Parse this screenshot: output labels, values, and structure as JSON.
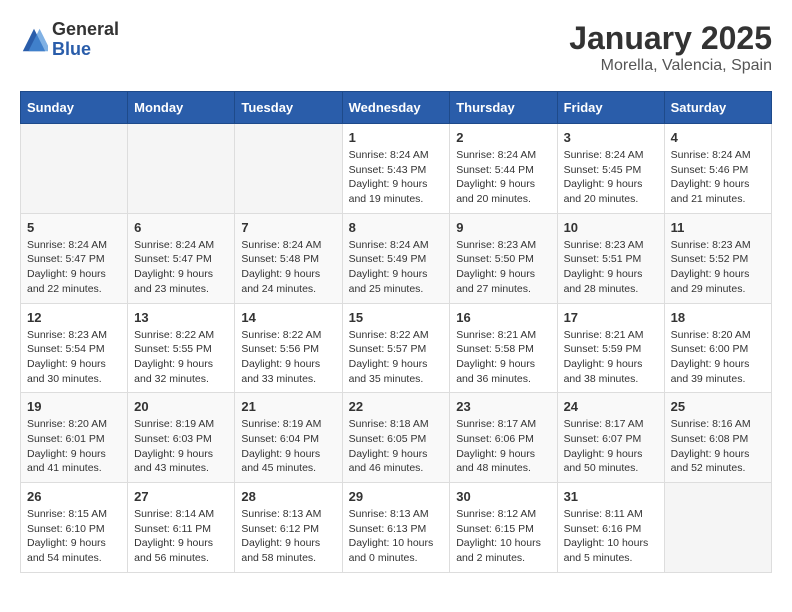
{
  "logo": {
    "general": "General",
    "blue": "Blue"
  },
  "title": "January 2025",
  "location": "Morella, Valencia, Spain",
  "weekdays": [
    "Sunday",
    "Monday",
    "Tuesday",
    "Wednesday",
    "Thursday",
    "Friday",
    "Saturday"
  ],
  "weeks": [
    [
      {
        "day": "",
        "info": ""
      },
      {
        "day": "",
        "info": ""
      },
      {
        "day": "",
        "info": ""
      },
      {
        "day": "1",
        "info": "Sunrise: 8:24 AM\nSunset: 5:43 PM\nDaylight: 9 hours and 19 minutes."
      },
      {
        "day": "2",
        "info": "Sunrise: 8:24 AM\nSunset: 5:44 PM\nDaylight: 9 hours and 20 minutes."
      },
      {
        "day": "3",
        "info": "Sunrise: 8:24 AM\nSunset: 5:45 PM\nDaylight: 9 hours and 20 minutes."
      },
      {
        "day": "4",
        "info": "Sunrise: 8:24 AM\nSunset: 5:46 PM\nDaylight: 9 hours and 21 minutes."
      }
    ],
    [
      {
        "day": "5",
        "info": "Sunrise: 8:24 AM\nSunset: 5:47 PM\nDaylight: 9 hours and 22 minutes."
      },
      {
        "day": "6",
        "info": "Sunrise: 8:24 AM\nSunset: 5:47 PM\nDaylight: 9 hours and 23 minutes."
      },
      {
        "day": "7",
        "info": "Sunrise: 8:24 AM\nSunset: 5:48 PM\nDaylight: 9 hours and 24 minutes."
      },
      {
        "day": "8",
        "info": "Sunrise: 8:24 AM\nSunset: 5:49 PM\nDaylight: 9 hours and 25 minutes."
      },
      {
        "day": "9",
        "info": "Sunrise: 8:23 AM\nSunset: 5:50 PM\nDaylight: 9 hours and 27 minutes."
      },
      {
        "day": "10",
        "info": "Sunrise: 8:23 AM\nSunset: 5:51 PM\nDaylight: 9 hours and 28 minutes."
      },
      {
        "day": "11",
        "info": "Sunrise: 8:23 AM\nSunset: 5:52 PM\nDaylight: 9 hours and 29 minutes."
      }
    ],
    [
      {
        "day": "12",
        "info": "Sunrise: 8:23 AM\nSunset: 5:54 PM\nDaylight: 9 hours and 30 minutes."
      },
      {
        "day": "13",
        "info": "Sunrise: 8:22 AM\nSunset: 5:55 PM\nDaylight: 9 hours and 32 minutes."
      },
      {
        "day": "14",
        "info": "Sunrise: 8:22 AM\nSunset: 5:56 PM\nDaylight: 9 hours and 33 minutes."
      },
      {
        "day": "15",
        "info": "Sunrise: 8:22 AM\nSunset: 5:57 PM\nDaylight: 9 hours and 35 minutes."
      },
      {
        "day": "16",
        "info": "Sunrise: 8:21 AM\nSunset: 5:58 PM\nDaylight: 9 hours and 36 minutes."
      },
      {
        "day": "17",
        "info": "Sunrise: 8:21 AM\nSunset: 5:59 PM\nDaylight: 9 hours and 38 minutes."
      },
      {
        "day": "18",
        "info": "Sunrise: 8:20 AM\nSunset: 6:00 PM\nDaylight: 9 hours and 39 minutes."
      }
    ],
    [
      {
        "day": "19",
        "info": "Sunrise: 8:20 AM\nSunset: 6:01 PM\nDaylight: 9 hours and 41 minutes."
      },
      {
        "day": "20",
        "info": "Sunrise: 8:19 AM\nSunset: 6:03 PM\nDaylight: 9 hours and 43 minutes."
      },
      {
        "day": "21",
        "info": "Sunrise: 8:19 AM\nSunset: 6:04 PM\nDaylight: 9 hours and 45 minutes."
      },
      {
        "day": "22",
        "info": "Sunrise: 8:18 AM\nSunset: 6:05 PM\nDaylight: 9 hours and 46 minutes."
      },
      {
        "day": "23",
        "info": "Sunrise: 8:17 AM\nSunset: 6:06 PM\nDaylight: 9 hours and 48 minutes."
      },
      {
        "day": "24",
        "info": "Sunrise: 8:17 AM\nSunset: 6:07 PM\nDaylight: 9 hours and 50 minutes."
      },
      {
        "day": "25",
        "info": "Sunrise: 8:16 AM\nSunset: 6:08 PM\nDaylight: 9 hours and 52 minutes."
      }
    ],
    [
      {
        "day": "26",
        "info": "Sunrise: 8:15 AM\nSunset: 6:10 PM\nDaylight: 9 hours and 54 minutes."
      },
      {
        "day": "27",
        "info": "Sunrise: 8:14 AM\nSunset: 6:11 PM\nDaylight: 9 hours and 56 minutes."
      },
      {
        "day": "28",
        "info": "Sunrise: 8:13 AM\nSunset: 6:12 PM\nDaylight: 9 hours and 58 minutes."
      },
      {
        "day": "29",
        "info": "Sunrise: 8:13 AM\nSunset: 6:13 PM\nDaylight: 10 hours and 0 minutes."
      },
      {
        "day": "30",
        "info": "Sunrise: 8:12 AM\nSunset: 6:15 PM\nDaylight: 10 hours and 2 minutes."
      },
      {
        "day": "31",
        "info": "Sunrise: 8:11 AM\nSunset: 6:16 PM\nDaylight: 10 hours and 5 minutes."
      },
      {
        "day": "",
        "info": ""
      }
    ]
  ]
}
